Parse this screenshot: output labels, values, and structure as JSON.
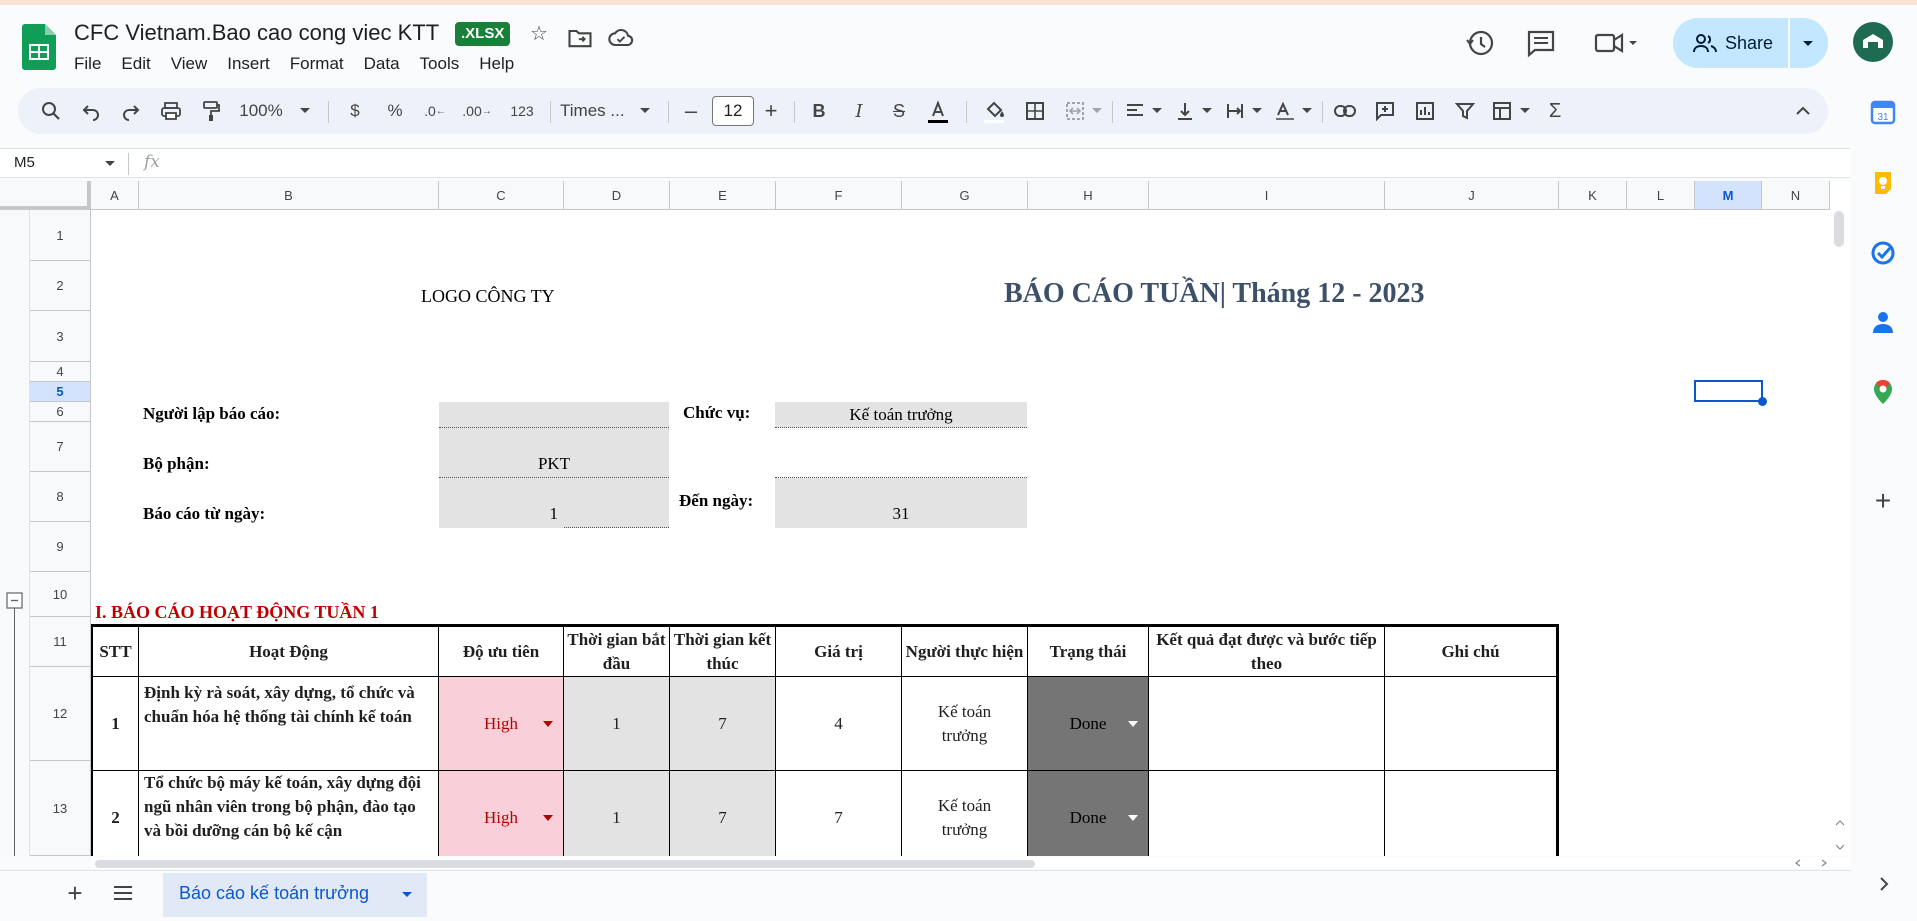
{
  "app": {
    "title": "CFC Vietnam.Bao cao cong viec KTT",
    "badge": ".XLSX",
    "menu": [
      "File",
      "Edit",
      "View",
      "Insert",
      "Format",
      "Data",
      "Tools",
      "Help"
    ],
    "share_label": "Share",
    "colors": {
      "brand": "#188038",
      "accent": "#0b57d0",
      "share_bg": "#c2e7ff"
    }
  },
  "toolbar": {
    "zoom": "100%",
    "currency": "$",
    "percent": "%",
    "dec_decrease": ".0",
    "dec_increase": ".00",
    "number_format": "123",
    "font": "Times ...",
    "font_size": "12"
  },
  "formula_bar": {
    "name_box": "M5",
    "fx": "fx"
  },
  "grid": {
    "columns": [
      "A",
      "B",
      "C",
      "D",
      "E",
      "F",
      "G",
      "H",
      "I",
      "J",
      "K",
      "L",
      "M",
      "N"
    ],
    "rows": [
      "1",
      "2",
      "3",
      "4",
      "5",
      "6",
      "7",
      "8",
      "9",
      "10",
      "11",
      "12",
      "13"
    ],
    "selected_cell": "M5"
  },
  "sheet": {
    "logo_text": "LOGO CÔNG TY",
    "report_title": "BÁO CÁO TUẦN| Tháng 12 - 2023",
    "fields": {
      "reporter_label": "Người lập báo cáo:",
      "position_label": "Chức vụ:",
      "position_value": "Kế toán trưởng",
      "dept_label": "Bộ phận:",
      "dept_value": "PKT",
      "from_label": "Báo cáo từ ngày:",
      "from_value": "1",
      "to_label": "Đến ngày:",
      "to_value": "31"
    },
    "section_title": "I. BÁO CÁO HOẠT ĐỘNG TUẦN 1",
    "table": {
      "headers": [
        "STT",
        "Hoạt Động",
        "Độ ưu tiên",
        "Thời gian bắt đầu",
        "Thời gian kết thúc",
        "Giá trị",
        "Người thực hiện",
        "Trạng thái",
        "Kết quả đạt được và bước tiếp theo",
        "Ghi chú"
      ],
      "rows": [
        {
          "stt": "1",
          "activity": "Định kỳ rà soát, xây dựng, tổ chức và chuẩn hóa hệ thống tài chính kế toán",
          "priority": "High",
          "start": "1",
          "end": "7",
          "value": "4",
          "owner": "Kế toán trưởng",
          "status": "Done",
          "result": "",
          "note": ""
        },
        {
          "stt": "2",
          "activity": "Tổ chức bộ máy kế toán, xây dựng đội ngũ nhân viên trong bộ phận, đào tạo và bồi dưỡng cán bộ kế cận",
          "priority": "High",
          "start": "1",
          "end": "7",
          "value": "7",
          "owner": "Kế toán trưởng",
          "status": "Done",
          "result": "",
          "note": ""
        }
      ]
    }
  },
  "sheet_tab": {
    "label": "Báo cáo kế toán trưởng"
  }
}
